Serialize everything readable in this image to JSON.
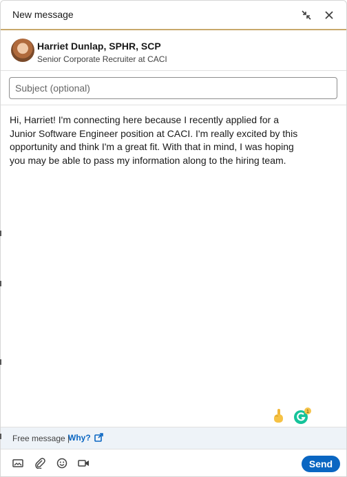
{
  "header": {
    "title": "New message",
    "minimize_icon": "collapse-arrows-icon",
    "close_icon": "close-icon"
  },
  "recipient": {
    "name": "Harriet Dunlap, SPHR, SCP",
    "headline": "Senior Corporate Recruiter at CACI"
  },
  "subject": {
    "placeholder": "Subject (optional)",
    "value": ""
  },
  "message": {
    "body": "Hi, Harriet! I'm connecting here because I recently applied for a Junior Software Engineer position at CACI. I'm really excited by this opportunity and think I'm a great fit. With that in mind, I was hoping you may be able to pass my information along to the hiring team."
  },
  "grammarly": {
    "badge_count": "1"
  },
  "footer": {
    "free_message_label": "Free message |",
    "why_label": "Why?"
  },
  "toolbar": {
    "send_label": "Send"
  },
  "colors": {
    "accent": "#0a66c2",
    "header_underline": "#c8a86b",
    "footer_bg": "#eef3f8",
    "grammarly": "#15c39a"
  }
}
